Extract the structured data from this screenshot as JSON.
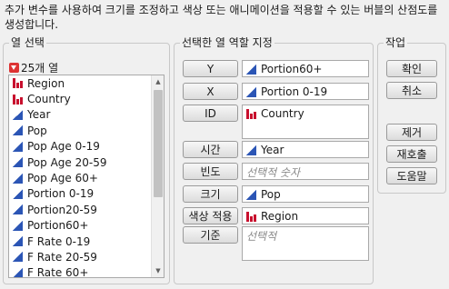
{
  "description": "추가 변수를 사용하여 크기를 조정하고 색상 또는 애니메이션을 적용할 수 있는 버블의 산점도를 생성합니다.",
  "columns_panel": {
    "title": "열 선택",
    "count_label": "25개 열",
    "items": [
      {
        "label": "Region",
        "icon": "nominal-icon"
      },
      {
        "label": "Country",
        "icon": "nominal-icon"
      },
      {
        "label": "Year",
        "icon": "continuous-icon"
      },
      {
        "label": "Pop",
        "icon": "continuous-icon"
      },
      {
        "label": "Pop Age 0-19",
        "icon": "continuous-icon"
      },
      {
        "label": "Pop Age 20-59",
        "icon": "continuous-icon"
      },
      {
        "label": "Pop Age 60+",
        "icon": "continuous-icon"
      },
      {
        "label": "Portion 0-19",
        "icon": "continuous-icon"
      },
      {
        "label": "Portion20-59",
        "icon": "continuous-icon"
      },
      {
        "label": "Portion60+",
        "icon": "continuous-icon"
      },
      {
        "label": "F Rate 0-19",
        "icon": "continuous-icon"
      },
      {
        "label": "F Rate 20-59",
        "icon": "continuous-icon"
      },
      {
        "label": "F Rate 60+",
        "icon": "continuous-icon"
      }
    ]
  },
  "roles_panel": {
    "title": "선택한 열 역할 지정",
    "roles": [
      {
        "button": "Y",
        "value": "Portion60+",
        "icon": "continuous-icon",
        "placeholder": ""
      },
      {
        "button": "X",
        "value": "Portion 0-19",
        "icon": "continuous-icon",
        "placeholder": ""
      },
      {
        "button": "ID",
        "value": "Country",
        "icon": "nominal-icon",
        "placeholder": ""
      },
      {
        "button": "시간",
        "value": "Year",
        "icon": "continuous-icon",
        "placeholder": ""
      },
      {
        "button": "빈도",
        "value": "",
        "icon": "",
        "placeholder": "선택적 숫자"
      },
      {
        "button": "크기",
        "value": "Pop",
        "icon": "continuous-icon",
        "placeholder": ""
      },
      {
        "button": "색상 적용",
        "value": "Region",
        "icon": "nominal-icon",
        "placeholder": ""
      },
      {
        "button": "기준",
        "value": "",
        "icon": "",
        "placeholder": "선택적"
      }
    ]
  },
  "actions_panel": {
    "title": "작업",
    "ok": "확인",
    "cancel": "취소",
    "remove": "제거",
    "recall": "재호출",
    "help": "도움말"
  }
}
